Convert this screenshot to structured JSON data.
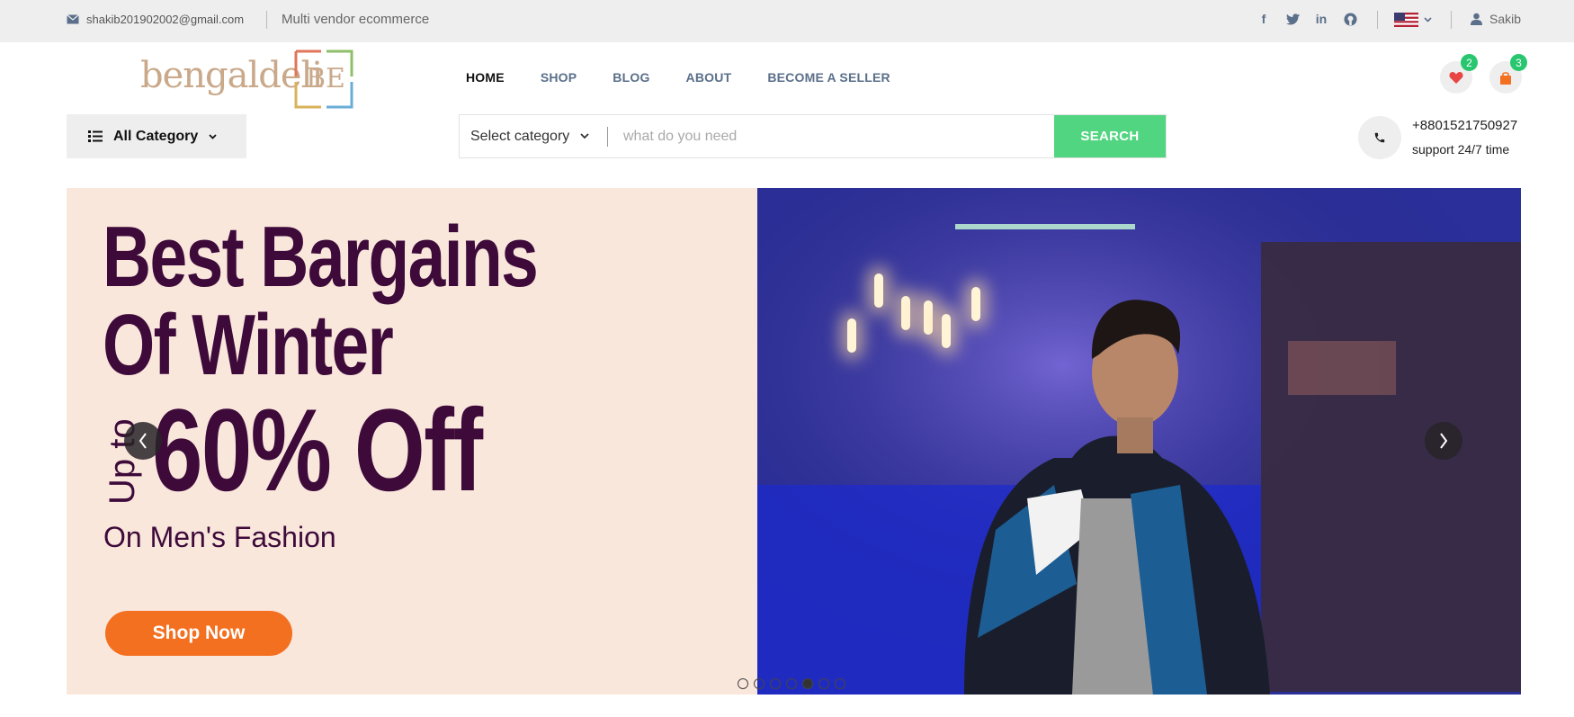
{
  "topbar": {
    "email": "shakib201902002@gmail.com",
    "tagline": "Multi vendor ecommerce",
    "user": "Sakib",
    "social_icons": [
      "facebook-icon",
      "twitter-icon",
      "linkedin-icon",
      "github-icon"
    ]
  },
  "header": {
    "logo_text": "bengaldeli",
    "logo_mark": "BE",
    "nav": [
      {
        "label": "HOME",
        "active": true
      },
      {
        "label": "SHOP"
      },
      {
        "label": "BLOG"
      },
      {
        "label": "ABOUT"
      },
      {
        "label": "BECOME A SELLER"
      }
    ],
    "wishlist_count": "2",
    "cart_count": "3"
  },
  "search": {
    "all_category": "All Category",
    "select_category": "Select category",
    "placeholder": "what do you need",
    "button": "SEARCH"
  },
  "support": {
    "phone": "+8801521750927",
    "text": "support 24/7 time"
  },
  "banner": {
    "line1": "Best Bargains",
    "line2": "Of Winter",
    "upto": "Up to",
    "discount": "60% Off",
    "subline": "On Men's Fashion",
    "cta": "Shop Now",
    "slide_count": 7,
    "active_slide": 5
  },
  "colors": {
    "accent_green": "#52d581",
    "cta_orange": "#f37021",
    "headline_purple": "#3d0a3a",
    "banner_bg": "#fae7dc"
  }
}
